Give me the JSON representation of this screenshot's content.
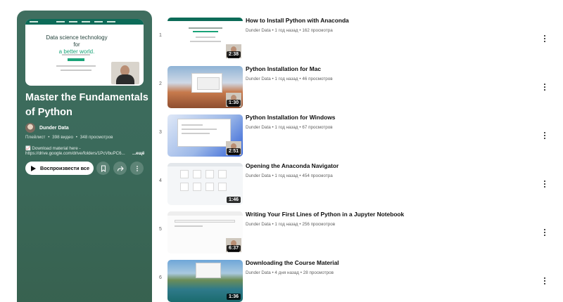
{
  "playlist": {
    "title": "Master the Fundamentals of Python",
    "owner": "Dunder Data",
    "meta_type": "Плейлист",
    "meta_videos": "398 видео",
    "meta_views": "348 просмотров",
    "desc_line1": "📈 Download material here -",
    "desc_line2": "https://drive.google.com/drive/folders/1PcVbuPC6...",
    "more_label": "...ещё",
    "play_label": "Воспроизвести все",
    "thumb_text_1": "Data science technology for",
    "thumb_text_2": "a better world."
  },
  "videos": [
    {
      "index": "1",
      "title": "How to Install Python with Anaconda",
      "channel": "Dunder Data",
      "age": "1 год назад",
      "views": "162 просмотра",
      "duration": "2:38"
    },
    {
      "index": "2",
      "title": "Python Installation for Mac",
      "channel": "Dunder Data",
      "age": "1 год назад",
      "views": "46 просмотров",
      "duration": "1:30"
    },
    {
      "index": "3",
      "title": "Python Installation for Windows",
      "channel": "Dunder Data",
      "age": "1 год назад",
      "views": "67 просмотров",
      "duration": "2:51"
    },
    {
      "index": "4",
      "title": "Opening the Anaconda Navigator",
      "channel": "Dunder Data",
      "age": "1 год назад",
      "views": "454 просмотра",
      "duration": "1:46"
    },
    {
      "index": "5",
      "title": "Writing Your First Lines of Python in a Jupyter Notebook",
      "channel": "Dunder Data",
      "age": "1 год назад",
      "views": "256 просмотров",
      "duration": "6:37"
    },
    {
      "index": "6",
      "title": "Downloading the Course Material",
      "channel": "Dunder Data",
      "age": "4 дня назад",
      "views": "28 просмотров",
      "duration": "1:36"
    }
  ],
  "meta_separator": "•",
  "icons": {
    "save": "bookmark-icon",
    "share": "share-icon",
    "more": "more-vert-icon",
    "play": "play-icon"
  },
  "colors": {
    "panel": "#3b6a5b",
    "accent": "#1aa378"
  }
}
